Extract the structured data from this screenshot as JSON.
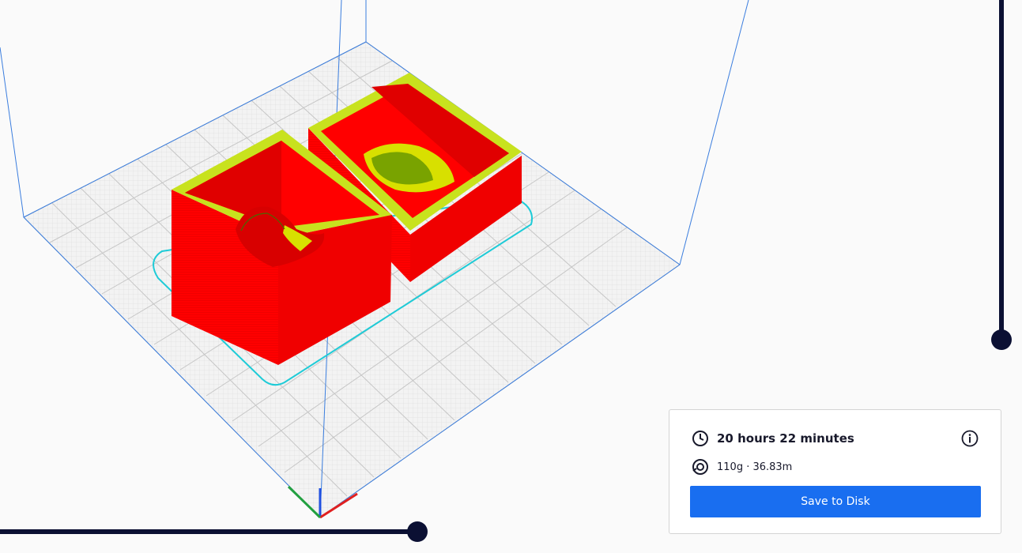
{
  "print_info": {
    "time": "20 hours 22 minutes",
    "material": "110g · 36.83m",
    "save_button": "Save to Disk"
  },
  "icons": {
    "time": "clock-icon",
    "material": "filament-spool-icon",
    "info": "info-icon"
  },
  "layer_slider": {
    "position_fraction": 1.0
  },
  "line_slider": {
    "position_fraction": 1.0
  },
  "colors": {
    "accent": "#196ef0",
    "model_wall": "#ff0000",
    "model_infill": "#c8e21e",
    "skirt": "#1ecbd7",
    "slider": "#0b1033",
    "build_volume_edges": "#3a7dde",
    "axis_x": "#e02020",
    "axis_y": "#22a040",
    "axis_z": "#2050e0"
  }
}
